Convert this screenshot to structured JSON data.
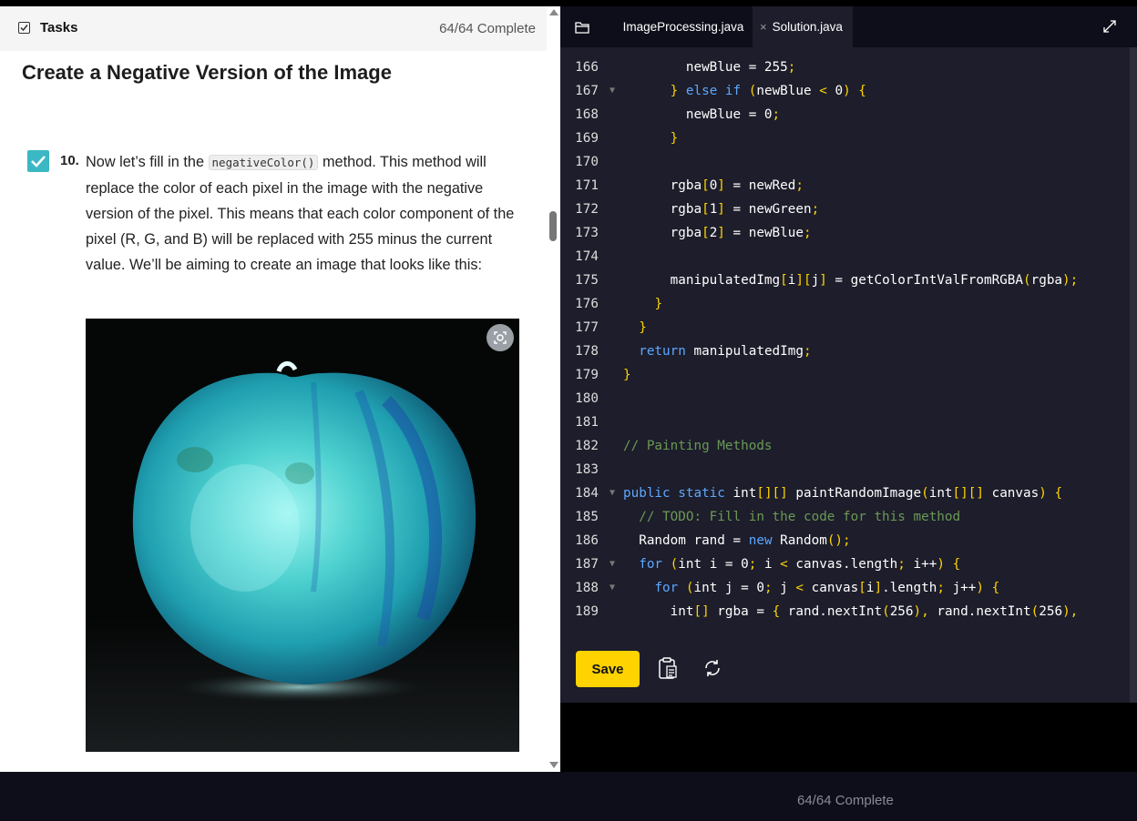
{
  "tasks": {
    "title": "Tasks",
    "progress": "64/64 Complete",
    "icon": "checkbox-icon"
  },
  "lesson": {
    "title": "Create a Negative Version of the Image",
    "step_number": "10.",
    "step_text_before": "Now let’s fill in the ",
    "step_code": "negativeColor()",
    "step_text_after": " method. This method will replace the color of each pixel in the image with the negative version of the pixel. This means that each color component of the pixel (R, G, and B) will be replaced with 255 minus the current value. We’ll be aiming to create an image that looks like this:"
  },
  "editor": {
    "tabs": [
      {
        "label": "ImageProcessing.java"
      },
      {
        "label": "Solution.java",
        "close": "×"
      }
    ],
    "lines": [
      {
        "n": "166",
        "fold": "",
        "code": [
          [
            "        newBlue = 255",
            ""
          ],
          [
            ";",
            "p"
          ]
        ]
      },
      {
        "n": "167",
        "fold": "▼",
        "code": [
          [
            "      ",
            ""
          ],
          [
            "}",
            "p"
          ],
          [
            " ",
            ""
          ],
          [
            "else if",
            "k"
          ],
          [
            " ",
            ""
          ],
          [
            "(",
            "p"
          ],
          [
            "newBlue ",
            ""
          ],
          [
            "<",
            "p"
          ],
          [
            " 0",
            ""
          ],
          [
            ")",
            "p"
          ],
          [
            " ",
            ""
          ],
          [
            "{",
            "p"
          ]
        ]
      },
      {
        "n": "168",
        "fold": "",
        "code": [
          [
            "        newBlue = 0",
            ""
          ],
          [
            ";",
            "p"
          ]
        ]
      },
      {
        "n": "169",
        "fold": "",
        "code": [
          [
            "      ",
            ""
          ],
          [
            "}",
            "p"
          ]
        ]
      },
      {
        "n": "170",
        "fold": "",
        "code": []
      },
      {
        "n": "171",
        "fold": "",
        "code": [
          [
            "      rgba",
            ""
          ],
          [
            "[",
            "p"
          ],
          [
            "0",
            ""
          ],
          [
            "]",
            "p"
          ],
          [
            " = newRed",
            ""
          ],
          [
            ";",
            "p"
          ]
        ]
      },
      {
        "n": "172",
        "fold": "",
        "code": [
          [
            "      rgba",
            ""
          ],
          [
            "[",
            "p"
          ],
          [
            "1",
            ""
          ],
          [
            "]",
            "p"
          ],
          [
            " = newGreen",
            ""
          ],
          [
            ";",
            "p"
          ]
        ]
      },
      {
        "n": "173",
        "fold": "",
        "code": [
          [
            "      rgba",
            ""
          ],
          [
            "[",
            "p"
          ],
          [
            "2",
            ""
          ],
          [
            "]",
            "p"
          ],
          [
            " = newBlue",
            ""
          ],
          [
            ";",
            "p"
          ]
        ]
      },
      {
        "n": "174",
        "fold": "",
        "code": []
      },
      {
        "n": "175",
        "fold": "",
        "code": [
          [
            "      manipulatedImg",
            ""
          ],
          [
            "[",
            "p"
          ],
          [
            "i",
            ""
          ],
          [
            "][",
            "p"
          ],
          [
            "j",
            ""
          ],
          [
            "]",
            "p"
          ],
          [
            " = getColorIntValFromRGBA",
            ""
          ],
          [
            "(",
            "p"
          ],
          [
            "rgba",
            ""
          ],
          [
            ");",
            "p"
          ]
        ]
      },
      {
        "n": "176",
        "fold": "",
        "code": [
          [
            "    ",
            ""
          ],
          [
            "}",
            "p"
          ]
        ]
      },
      {
        "n": "177",
        "fold": "",
        "code": [
          [
            "  ",
            ""
          ],
          [
            "}",
            "p"
          ]
        ]
      },
      {
        "n": "178",
        "fold": "",
        "code": [
          [
            "  ",
            ""
          ],
          [
            "return",
            "k"
          ],
          [
            " manipulatedImg",
            ""
          ],
          [
            ";",
            "p"
          ]
        ]
      },
      {
        "n": "179",
        "fold": "",
        "code": [
          [
            "}",
            "p"
          ]
        ]
      },
      {
        "n": "180",
        "fold": "",
        "code": []
      },
      {
        "n": "181",
        "fold": "",
        "code": []
      },
      {
        "n": "182",
        "fold": "",
        "code": [
          [
            "// Painting Methods",
            "c"
          ]
        ]
      },
      {
        "n": "183",
        "fold": "",
        "code": []
      },
      {
        "n": "184",
        "fold": "▼",
        "code": [
          [
            "public static",
            "k"
          ],
          [
            " int",
            ""
          ],
          [
            "[][]",
            "p"
          ],
          [
            " paintRandomImage",
            ""
          ],
          [
            "(",
            "p"
          ],
          [
            "int",
            ""
          ],
          [
            "[][]",
            "p"
          ],
          [
            " canvas",
            ""
          ],
          [
            ")",
            "p"
          ],
          [
            " ",
            ""
          ],
          [
            "{",
            "p"
          ]
        ]
      },
      {
        "n": "185",
        "fold": "",
        "code": [
          [
            "  ",
            ""
          ],
          [
            "// TODO: Fill in the code for this method",
            "c"
          ]
        ]
      },
      {
        "n": "186",
        "fold": "",
        "code": [
          [
            "  Random rand = ",
            ""
          ],
          [
            "new",
            "k"
          ],
          [
            " Random",
            ""
          ],
          [
            "();",
            "p"
          ]
        ]
      },
      {
        "n": "187",
        "fold": "▼",
        "code": [
          [
            "  ",
            ""
          ],
          [
            "for",
            "k"
          ],
          [
            " ",
            ""
          ],
          [
            "(",
            "p"
          ],
          [
            "int i = 0",
            ""
          ],
          [
            ";",
            "p"
          ],
          [
            " i ",
            ""
          ],
          [
            "<",
            "p"
          ],
          [
            " canvas.length",
            ""
          ],
          [
            ";",
            "p"
          ],
          [
            " i++",
            ""
          ],
          [
            ")",
            "p"
          ],
          [
            " ",
            ""
          ],
          [
            "{",
            "p"
          ]
        ]
      },
      {
        "n": "188",
        "fold": "▼",
        "code": [
          [
            "    ",
            ""
          ],
          [
            "for",
            "k"
          ],
          [
            " ",
            ""
          ],
          [
            "(",
            "p"
          ],
          [
            "int j = 0",
            ""
          ],
          [
            ";",
            "p"
          ],
          [
            " j ",
            ""
          ],
          [
            "<",
            "p"
          ],
          [
            " canvas",
            ""
          ],
          [
            "[",
            "p"
          ],
          [
            "i",
            ""
          ],
          [
            "]",
            "p"
          ],
          [
            ".length",
            ""
          ],
          [
            ";",
            "p"
          ],
          [
            " j++",
            ""
          ],
          [
            ")",
            "p"
          ],
          [
            " ",
            ""
          ],
          [
            "{",
            "p"
          ]
        ]
      },
      {
        "n": "189",
        "fold": "",
        "code": [
          [
            "      int",
            ""
          ],
          [
            "[]",
            "p"
          ],
          [
            " rgba = ",
            ""
          ],
          [
            "{",
            "p"
          ],
          [
            " rand.nextInt",
            ""
          ],
          [
            "(",
            "p"
          ],
          [
            "256",
            ""
          ],
          [
            "),",
            "p"
          ],
          [
            " rand.nextInt",
            ""
          ],
          [
            "(",
            "p"
          ],
          [
            "256",
            ""
          ],
          [
            "),",
            "p"
          ]
        ]
      }
    ],
    "save_label": "Save",
    "icons": [
      "folder-icon",
      "expand-icon",
      "clipboard-icon",
      "reset-icon"
    ]
  },
  "footer": {
    "progress": "64/64 Complete"
  },
  "colors": {
    "accent_yellow": "#ffd300",
    "check_teal": "#3bb8c3",
    "editor_bg": "#1d1d2b",
    "keyword": "#5da8ff",
    "punct": "#ffd500",
    "comment": "#6a9955"
  }
}
